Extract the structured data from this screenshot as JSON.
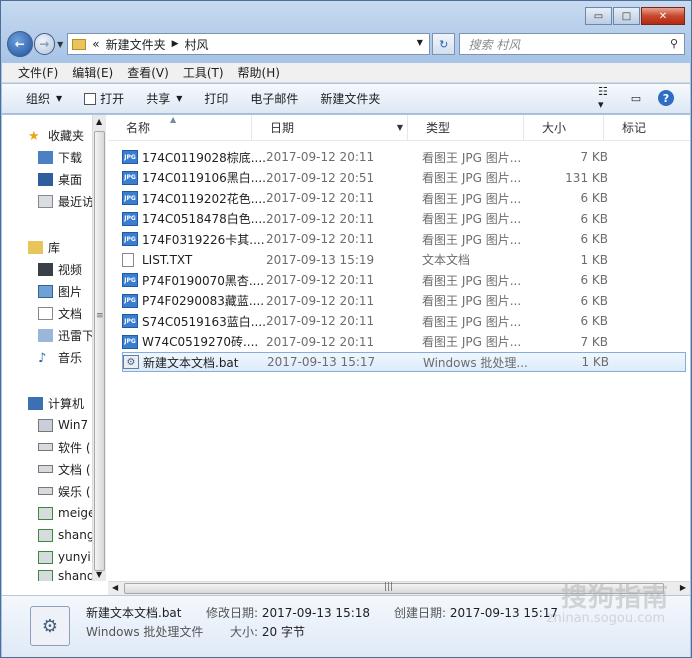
{
  "window": {
    "caption_buttons": {
      "minimize": "▭",
      "maximize": "□",
      "close": "✕"
    }
  },
  "address": {
    "prefix": "«",
    "crumbs": [
      "新建文件夹",
      "村风"
    ],
    "search_placeholder": "搜索 村风"
  },
  "menu": [
    "文件(F)",
    "编辑(E)",
    "查看(V)",
    "工具(T)",
    "帮助(H)"
  ],
  "commands": [
    "组织",
    "打开",
    "共享",
    "打印",
    "电子邮件",
    "新建文件夹"
  ],
  "nav": {
    "favorites": "收藏夹",
    "fav_items": [
      "下载",
      "桌面",
      "最近访"
    ],
    "library": "库",
    "lib_items": [
      "视频",
      "图片",
      "文档",
      "迅雷下",
      "音乐"
    ],
    "computer": "计算机",
    "comp_items": [
      "Win7",
      "软件 (",
      "文档 (",
      "娱乐 (",
      "meige",
      "shang",
      "yunyi",
      "shang"
    ]
  },
  "columns": [
    "名称",
    "日期",
    "类型",
    "大小",
    "标记"
  ],
  "files": [
    {
      "name": "174C0119028棕底....",
      "date": "2017-09-12 20:11",
      "type": "看图王 JPG 图片...",
      "size": "7 KB",
      "icon": "jpg-icon"
    },
    {
      "name": "174C0119106黑白....",
      "date": "2017-09-12 20:51",
      "type": "看图王 JPG 图片...",
      "size": "131 KB",
      "icon": "jpg-icon"
    },
    {
      "name": "174C0119202花色....",
      "date": "2017-09-12 20:11",
      "type": "看图王 JPG 图片...",
      "size": "6 KB",
      "icon": "jpg-icon"
    },
    {
      "name": "174C0518478白色....",
      "date": "2017-09-12 20:11",
      "type": "看图王 JPG 图片...",
      "size": "6 KB",
      "icon": "jpg-icon"
    },
    {
      "name": "174F0319226卡其....",
      "date": "2017-09-12 20:11",
      "type": "看图王 JPG 图片...",
      "size": "6 KB",
      "icon": "jpg-icon"
    },
    {
      "name": "LIST.TXT",
      "date": "2017-09-13 15:19",
      "type": "文本文档",
      "size": "1 KB",
      "icon": "txt-icon"
    },
    {
      "name": "P74F0190070黑杏....",
      "date": "2017-09-12 20:11",
      "type": "看图王 JPG 图片...",
      "size": "6 KB",
      "icon": "jpg-icon"
    },
    {
      "name": "P74F0290083藏蓝....",
      "date": "2017-09-12 20:11",
      "type": "看图王 JPG 图片...",
      "size": "6 KB",
      "icon": "jpg-icon"
    },
    {
      "name": "S74C0519163蓝白....",
      "date": "2017-09-12 20:11",
      "type": "看图王 JPG 图片...",
      "size": "6 KB",
      "icon": "jpg-icon"
    },
    {
      "name": "W74C0519270砖....",
      "date": "2017-09-12 20:11",
      "type": "看图王 JPG 图片...",
      "size": "7 KB",
      "icon": "jpg-icon"
    },
    {
      "name": "新建文本文档.bat",
      "date": "2017-09-13 15:17",
      "type": "Windows 批处理...",
      "size": "1 KB",
      "icon": "bat-icon",
      "selected": true
    }
  ],
  "details": {
    "name": "新建文本文档.bat",
    "type": "Windows 批处理文件",
    "modified_label": "修改日期:",
    "modified": "2017-09-13 15:18",
    "created_label": "创建日期:",
    "created": "2017-09-13 15:17",
    "size_label": "大小:",
    "size": "20 字节"
  },
  "watermark": {
    "text": "搜狗指南",
    "url": "zhinan.sogou.com"
  },
  "colors": {
    "selected_row": "#dcebfc",
    "jpg_icon": "#3a7fcf",
    "window_frame": "#a8c4e6"
  }
}
